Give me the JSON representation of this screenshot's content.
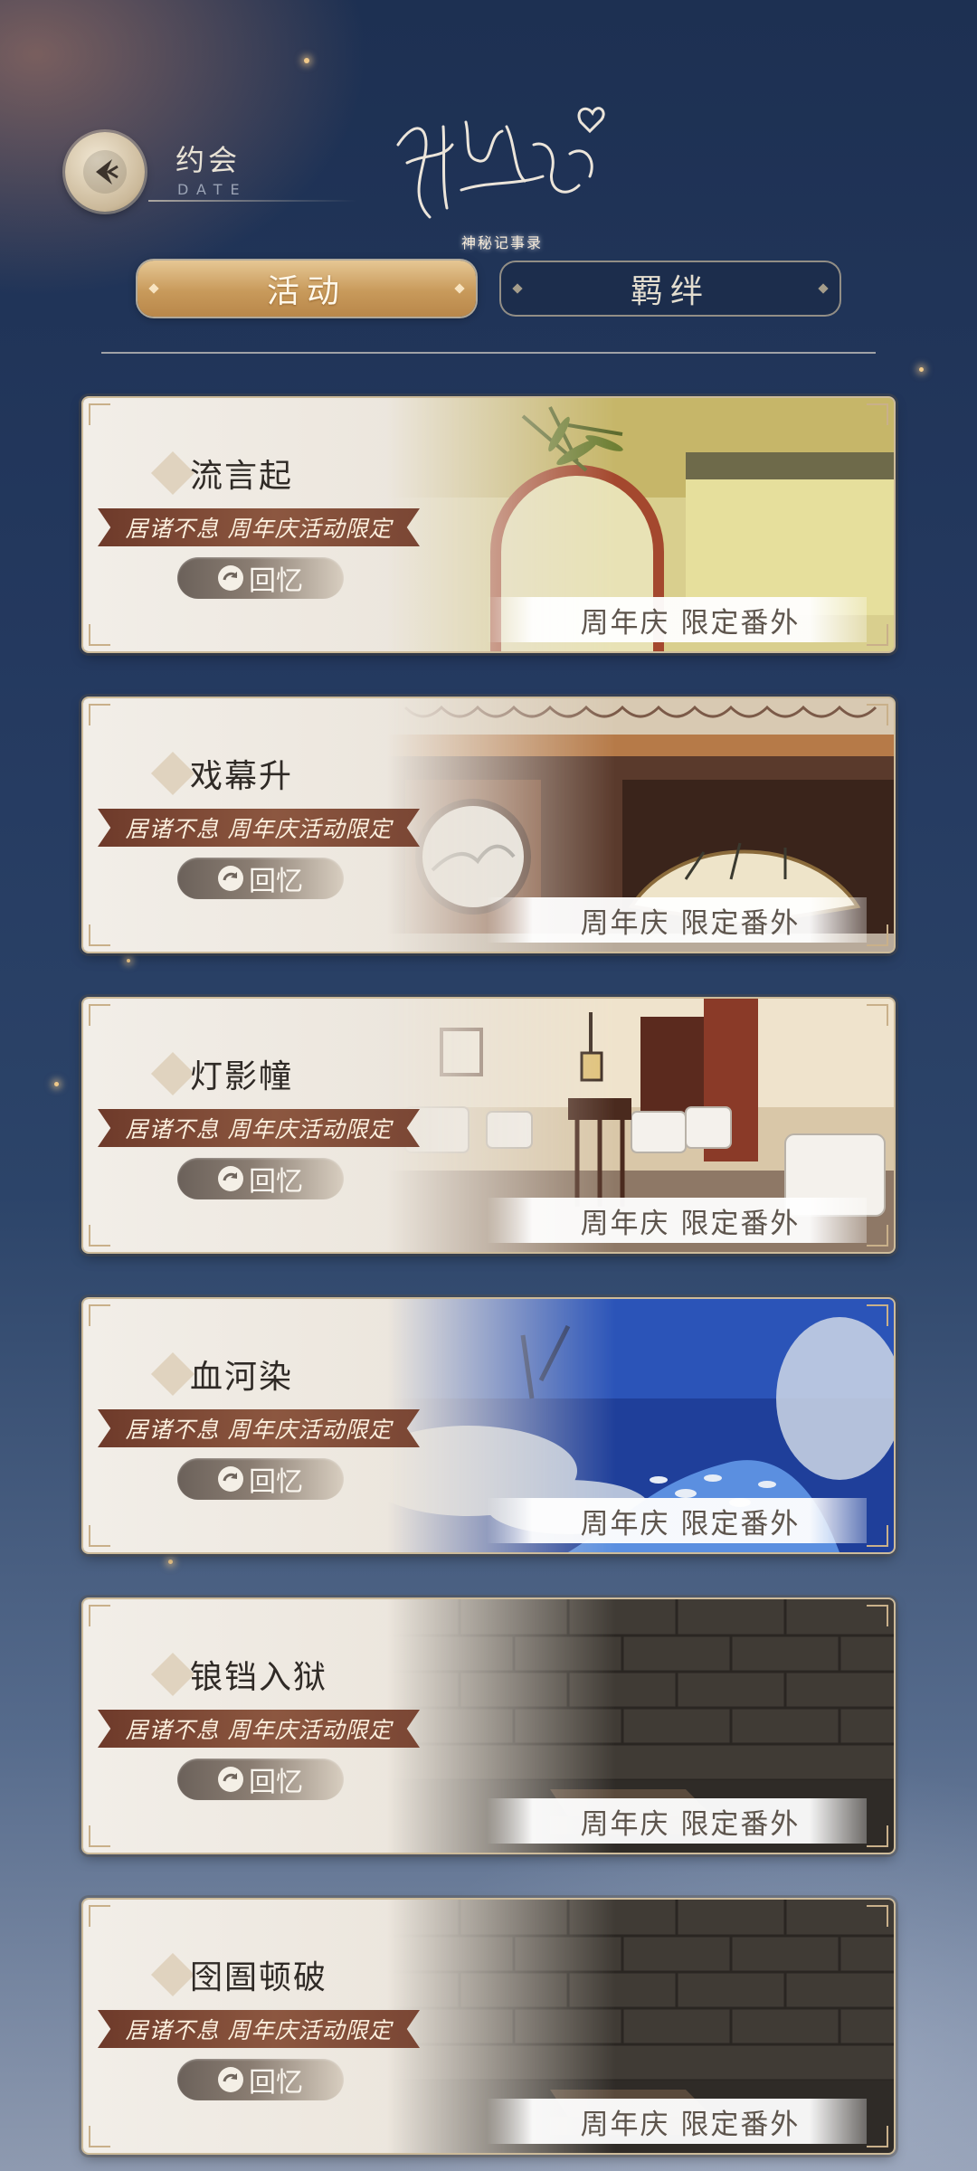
{
  "header": {
    "back_icon": "back-arrow-icon",
    "title": "约会",
    "subtitle": "DATE",
    "logo_caption": "神秘记事录"
  },
  "tabs": [
    {
      "label": "活动",
      "active": true
    },
    {
      "label": "羁绊",
      "active": false
    }
  ],
  "cards": [
    {
      "title": "流言起",
      "ribbon": "居诸不息 周年庆活动限定",
      "recall_label": "回忆",
      "tag": "周年庆 限定番外",
      "scene": "garden-moon-gate"
    },
    {
      "title": "戏幕升",
      "ribbon": "居诸不息 周年庆活动限定",
      "recall_label": "回忆",
      "tag": "周年庆 限定番外",
      "scene": "theater-fan"
    },
    {
      "title": "灯影幢",
      "ribbon": "居诸不息 周年庆活动限定",
      "recall_label": "回忆",
      "tag": "周年庆 限定番外",
      "scene": "parlor-lounge"
    },
    {
      "title": "血河染",
      "ribbon": "居诸不息 周年庆活动限定",
      "recall_label": "回忆",
      "tag": "周年庆 限定番外",
      "scene": "snowy-river-night"
    },
    {
      "title": "锒铛入狱",
      "ribbon": "居诸不息 周年庆活动限定",
      "recall_label": "回忆",
      "tag": "周年庆 限定番外",
      "scene": "prison-brick-wall"
    },
    {
      "title": "囹圄顿破",
      "ribbon": "居诸不息 周年庆活动限定",
      "recall_label": "回忆",
      "tag": "周年庆 限定番外",
      "scene": "prison-brick-wall"
    }
  ],
  "colors": {
    "accent_gold": "#c89a5b",
    "ribbon_brown": "#7a4634",
    "background_navy": "#24395f"
  }
}
